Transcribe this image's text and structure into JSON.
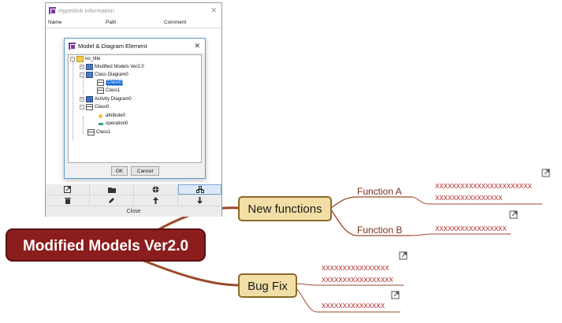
{
  "mindmap": {
    "central": "Modified Models Ver2.0",
    "branches": [
      {
        "label": "New functions",
        "children": [
          {
            "label": "Function A",
            "notes": [
              "XXXXXXXXXXXXXXXXXXXXXXX",
              "XXXXXXXXXXXXXXXX"
            ]
          },
          {
            "label": "Function B",
            "notes": [
              "XXXXXXXXXXXXXXXXX"
            ]
          }
        ]
      },
      {
        "label": "Bug Fix",
        "notes_top": [
          "XXXXXXXXXXXXXXXX",
          "XXXXXXXXXXXXXXXXX"
        ],
        "notes_bottom": [
          "XXXXXXXXXXXXXXX"
        ]
      }
    ],
    "colors": {
      "topic_fill": "#f2dfa6",
      "topic_border": "#8b6a2a",
      "central_fill": "#8c1d1d",
      "branch_line": "#9c4a2c"
    }
  },
  "hyperlink_window": {
    "title": "Hyperlink Information",
    "columns": [
      "Name",
      "Path",
      "Comment"
    ],
    "toolbar_icons": [
      "open-link-icon",
      "folder-icon",
      "globe-icon",
      "model-element-icon",
      "trash-icon",
      "pen-icon",
      "arrow-up-icon",
      "arrow-down-icon"
    ],
    "close_label": "Close"
  },
  "model_dialog": {
    "title": "Model & Diagram Element",
    "tree": {
      "root": "no_title",
      "modified_models": "Modified Models Ver2.0",
      "class_diagram": "Class Diagram0",
      "class0_sel": "Class0",
      "class1": "Class1",
      "activity_diagram": "Activity Diagram0",
      "class0": "Class0",
      "attribute": "attribute0",
      "operation": "operation0",
      "class1_root": "Class1"
    },
    "ok_label": "OK",
    "cancel_label": "Cancel"
  }
}
